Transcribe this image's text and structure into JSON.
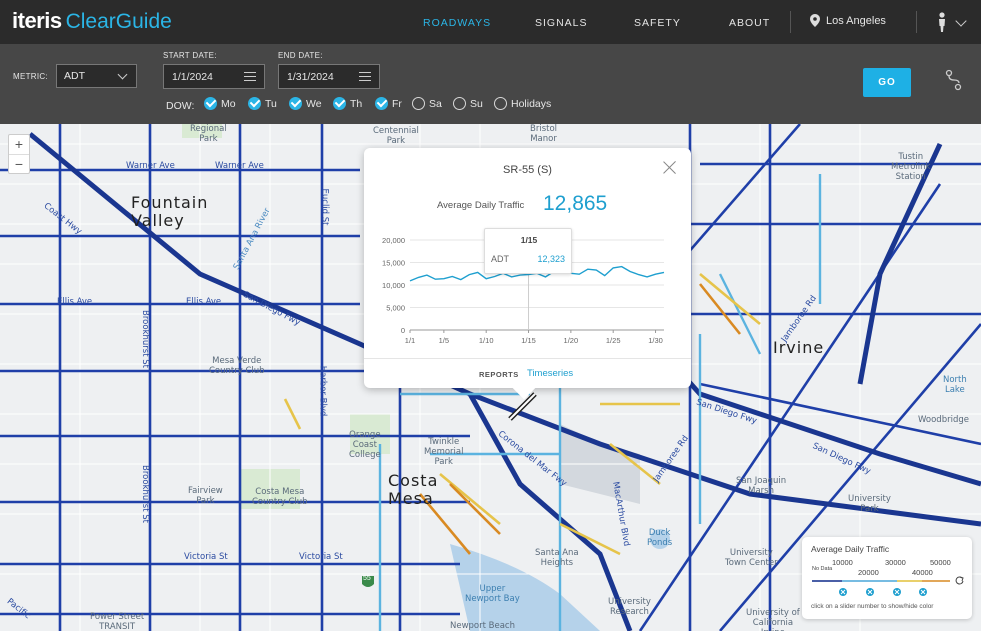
{
  "app": {
    "brand_bold": "iteris",
    "brand_product": "ClearGuide"
  },
  "nav": {
    "items": [
      {
        "label": "ROADWAYS",
        "active": true
      },
      {
        "label": "SIGNALS",
        "active": false
      },
      {
        "label": "SAFETY",
        "active": false
      },
      {
        "label": "ABOUT",
        "active": false
      }
    ],
    "location": "Los Angeles"
  },
  "filters": {
    "metric_label": "METRIC:",
    "metric_value": "ADT",
    "start_label": "START DATE:",
    "start_value": "1/1/2024",
    "end_label": "END DATE:",
    "end_value": "1/31/2024",
    "dow_label": "DOW:",
    "days": [
      {
        "label": "Mo",
        "checked": true
      },
      {
        "label": "Tu",
        "checked": true
      },
      {
        "label": "We",
        "checked": true
      },
      {
        "label": "Th",
        "checked": true
      },
      {
        "label": "Fr",
        "checked": true
      },
      {
        "label": "Sa",
        "checked": false
      },
      {
        "label": "Su",
        "checked": false
      },
      {
        "label": "Holidays",
        "checked": false
      }
    ],
    "go_label": "GO"
  },
  "map": {
    "places": {
      "fountain_valley": "Fountain\nValley",
      "costa_mesa": "Costa\nMesa",
      "irvine": "Irvine",
      "regional_park": "Regional\nPark",
      "centennial_park": "Centennial\nPark",
      "bristol_manor": "Bristol\nManor",
      "tustin": "Tustin\nMetrolink\nStation",
      "mesa_verde": "Mesa Verde\nCountry Club",
      "orange_coast": "Orange\nCoast\nCollege",
      "twinkle": "Twinkle\nMemorial\nPark",
      "fairview": "Fairview\nPark",
      "costa_mesa_cc": "Costa Mesa\nCountry Club",
      "san_joaquin": "San Joaquin\nMarsh",
      "duck_ponds": "Duck\nPonds",
      "santa_ana_heights": "Santa Ana\nHeights",
      "upper_newport": "Upper\nNewport Bay",
      "university_park": "University\nPark",
      "university_town": "University\nTown Center",
      "north_lake": "North\nLake",
      "woodbridge": "Woodbridge",
      "university_research": "University\nResearch",
      "uc_irvine": "University of\nCalifornia\nIrvine",
      "power_street": "Power Street\nTRANSIT",
      "newport_beach": "Newport Beach"
    },
    "streets": {
      "warner1": "Warner Ave",
      "warner2": "Warner Ave",
      "ellis1": "Ellis Ave",
      "ellis2": "Ellis Ave",
      "san_diego_fwy1": "San Diego Fwy",
      "san_diego_fwy2": "San Diego Fwy",
      "san_diego_fwy3": "San Diego Fwy",
      "brookhurst1": "Brookhurst St",
      "brookhurst2": "Brookhurst St",
      "harbor": "Harbor Blvd",
      "euclid": "Euclid St",
      "victoria1": "Victoria St",
      "victoria2": "Victoria St",
      "jamboree1": "Jamboree Rd",
      "jamboree2": "Jamboree Rd",
      "macarthur": "MacArthur Blvd",
      "corona": "Corona del Mar Fwy",
      "santa_ana_river": "Santa Ana River",
      "pacific": "Pacific",
      "coast_hwy": "Coast Hwy"
    },
    "badge_55": "55"
  },
  "popup": {
    "title": "SR-55 (S)",
    "metric_name": "Average Daily Traffic",
    "metric_value": "12,865",
    "tooltip": {
      "date": "1/15",
      "label": "ADT",
      "value": "12,323"
    },
    "reports_label": "REPORTS",
    "timeseries_label": "Timeseries"
  },
  "chart_data": {
    "type": "line",
    "title": "",
    "xlabel": "",
    "ylabel": "",
    "ylim": [
      0,
      20000
    ],
    "yticks": [
      "0",
      "5,000",
      "10,000",
      "15,000",
      "20,000"
    ],
    "xticks": [
      "1/1",
      "1/5",
      "1/10",
      "1/15",
      "1/20",
      "1/25",
      "1/30"
    ],
    "x": [
      1,
      2,
      3,
      4,
      5,
      6,
      7,
      8,
      9,
      10,
      11,
      12,
      13,
      14,
      15,
      16,
      17,
      18,
      19,
      20,
      21,
      22,
      23,
      24,
      25,
      26,
      27,
      28,
      29,
      30,
      31
    ],
    "series": [
      {
        "name": "ADT",
        "color": "#1e9fcf",
        "values": [
          10900,
          11700,
          12200,
          11300,
          11400,
          11900,
          11200,
          12300,
          12800,
          11400,
          11900,
          12600,
          11800,
          12200,
          12323,
          12600,
          11800,
          13000,
          12700,
          12600,
          12400,
          13500,
          13300,
          12100,
          13800,
          14100,
          13000,
          12300,
          11800,
          12400,
          12800
        ]
      }
    ],
    "grid": true,
    "legend": "none"
  },
  "legend": {
    "title": "Average Daily Traffic",
    "ticks_top": [
      "10000",
      "30000",
      "50000"
    ],
    "ticks_bottom": [
      "20000",
      "40000"
    ],
    "nodata": "No Data",
    "note": "click on a slider number to show/hide color",
    "colors": [
      "#0f2a8a",
      "#4aa6d8",
      "#e2c13a",
      "#d98a22"
    ]
  }
}
